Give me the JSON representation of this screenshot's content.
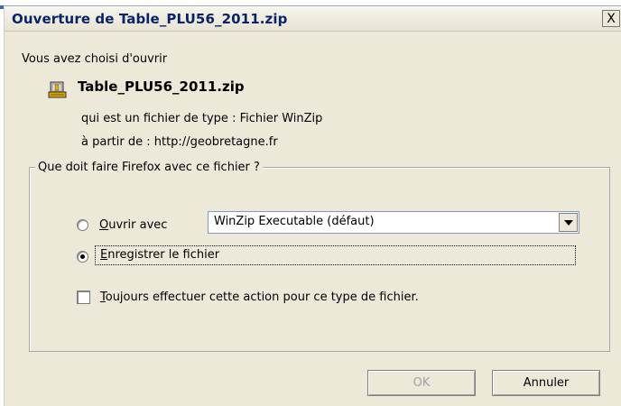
{
  "window": {
    "title": "Ouverture de Table_PLU56_2011.zip",
    "close_label": "X"
  },
  "intro": "Vous avez choisi d'ouvrir",
  "file": {
    "name": "Table_PLU56_2011.zip",
    "icon": "winzip-file-icon",
    "type_line": "qui est un fichier de type :  Fichier WinZip",
    "source_line": "à partir de : http://geobretagne.fr"
  },
  "action_group": {
    "legend": "Que doit faire Firefox avec ce fichier ?",
    "open_with": {
      "label_mnemonic": "O",
      "label_rest": "uvrir avec",
      "selected": false
    },
    "app_select": {
      "value": "WinZip Executable (défaut)"
    },
    "save_file": {
      "label_mnemonic": "E",
      "label_rest": "nregistrer le fichier",
      "selected": true
    },
    "always": {
      "label_mnemonic": "T",
      "label_rest": "oujours effectuer cette action pour ce type de fichier.",
      "checked": false
    }
  },
  "buttons": {
    "ok": "OK",
    "cancel": "Annuler"
  },
  "colors": {
    "title_text": "#0a246a",
    "dialog_bg": "#ece9d8",
    "disabled_text": "#a0a0a0"
  }
}
